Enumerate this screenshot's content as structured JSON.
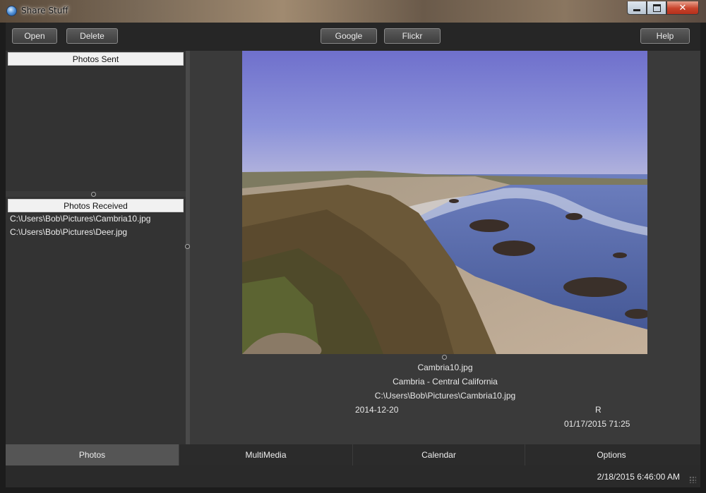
{
  "window": {
    "title": "Share Stuff"
  },
  "toolbar": {
    "open": "Open",
    "delete": "Delete",
    "google": "Google",
    "flickr": "Flickr",
    "help": "Help"
  },
  "sent": {
    "header": "Photos Sent",
    "items": []
  },
  "received": {
    "header": "Photos Received",
    "items": [
      "C:\\Users\\Bob\\Pictures\\Cambria10.jpg",
      "C:\\Users\\Bob\\Pictures\\Deer.jpg"
    ]
  },
  "details": {
    "filename": "Cambria10.jpg",
    "caption": "Cambria - Central California",
    "path": "C:\\Users\\Bob\\Pictures\\Cambria10.jpg",
    "date": "2014-12-20",
    "flag": "R",
    "timestamp": "01/17/2015 71:25"
  },
  "tabs": [
    {
      "label": "Photos",
      "active": true
    },
    {
      "label": "MultiMedia",
      "active": false
    },
    {
      "label": "Calendar",
      "active": false
    },
    {
      "label": "Options",
      "active": false
    }
  ],
  "status": {
    "clock": "2/18/2015 6:46:00 AM"
  },
  "colors": {
    "sky": "#7f88d6",
    "sea": "#4b5f9e",
    "sand": "#b8a48a",
    "cliff": "#6e5a3c"
  }
}
